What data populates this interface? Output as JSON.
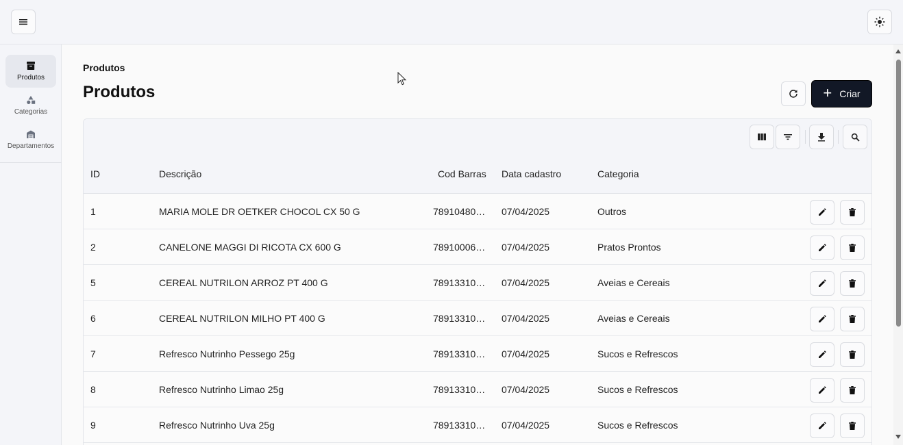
{
  "header": {
    "menu_icon": "hamburger-menu-icon",
    "theme_icon": "sun-icon"
  },
  "sidebar": {
    "items": [
      {
        "label": "Produtos",
        "icon": "archive-box-icon",
        "active": true
      },
      {
        "label": "Categorias",
        "icon": "shapes-icon",
        "active": false
      },
      {
        "label": "Departamentos",
        "icon": "warehouse-icon",
        "active": false
      }
    ]
  },
  "main": {
    "breadcrumb": "Produtos",
    "title": "Produtos",
    "refresh_icon": "refresh-icon",
    "create_label": "Criar"
  },
  "toolbar": {
    "columns_icon": "columns-icon",
    "filter_icon": "filter-icon",
    "download_icon": "download-icon",
    "search_icon": "search-icon"
  },
  "table": {
    "columns": [
      "ID",
      "Descrição",
      "Cod Barras",
      "Data cadastro",
      "Categoria"
    ],
    "rows": [
      {
        "id": "1",
        "descricao": "MARIA MOLE DR OETKER CHOCOL CX 50 G",
        "cod": "78910480…",
        "data": "07/04/2025",
        "categoria": "Outros"
      },
      {
        "id": "2",
        "descricao": "CANELONE MAGGI DI RICOTA CX 600 G",
        "cod": "78910006…",
        "data": "07/04/2025",
        "categoria": "Pratos Prontos"
      },
      {
        "id": "5",
        "descricao": "CEREAL NUTRILON ARROZ PT 400 G",
        "cod": "78913310…",
        "data": "07/04/2025",
        "categoria": "Aveias e Cereais"
      },
      {
        "id": "6",
        "descricao": "CEREAL NUTRILON MILHO PT 400 G",
        "cod": "78913310…",
        "data": "07/04/2025",
        "categoria": "Aveias e Cereais"
      },
      {
        "id": "7",
        "descricao": "Refresco Nutrinho Pessego 25g",
        "cod": "78913310…",
        "data": "07/04/2025",
        "categoria": "Sucos e Refrescos"
      },
      {
        "id": "8",
        "descricao": "Refresco Nutrinho Limao 25g",
        "cod": "78913310…",
        "data": "07/04/2025",
        "categoria": "Sucos e Refrescos"
      },
      {
        "id": "9",
        "descricao": "Refresco Nutrinho Uva 25g",
        "cod": "78913310…",
        "data": "07/04/2025",
        "categoria": "Sucos e Refrescos"
      }
    ]
  }
}
